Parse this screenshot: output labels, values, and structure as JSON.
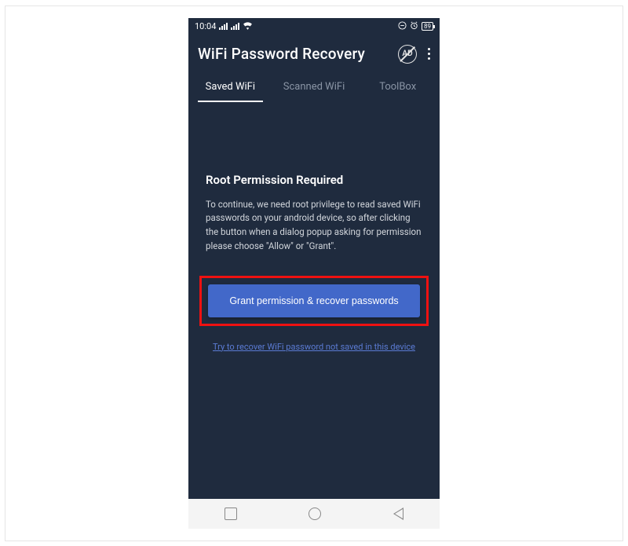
{
  "status_bar": {
    "time": "10:04",
    "battery": "89"
  },
  "app_bar": {
    "title": "WiFi Password Recovery",
    "ad_label": "AD"
  },
  "tabs": [
    {
      "label": "Saved WiFi",
      "active": true
    },
    {
      "label": "Scanned WiFi",
      "active": false
    },
    {
      "label": "ToolBox",
      "active": false
    }
  ],
  "content": {
    "heading": "Root Permission Required",
    "body": "To continue, we need root privilege to read saved WiFi passwords on your android device, so after clicking the button when a dialog popup asking for permission please choose \"Allow\" or \"Grant\".",
    "button_label": "Grant permission & recover passwords",
    "link_label": "Try to recover WiFi password not saved in this device"
  }
}
